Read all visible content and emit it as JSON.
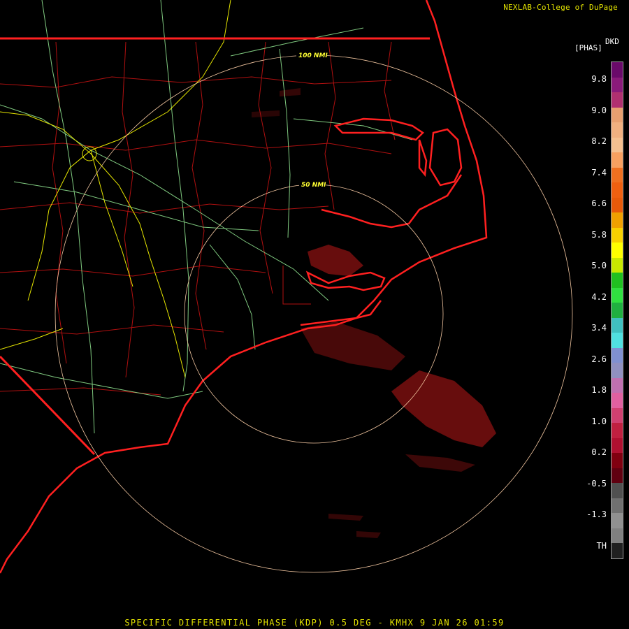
{
  "credit": "NEXLAB-College of DuPage",
  "colorbar": {
    "product_code": "DKD",
    "units": "[PHAS]",
    "tick_labels": [
      "9.8",
      "9.0",
      "8.2",
      "7.4",
      "6.6",
      "5.8",
      "5.0",
      "4.2",
      "3.4",
      "2.6",
      "1.8",
      "1.0",
      "0.2",
      "-0.5",
      "-1.3",
      "TH"
    ],
    "colors": [
      "#6a0a6a",
      "#8a1a7a",
      "#b03070",
      "#e8a070",
      "#f0b080",
      "#f5c090",
      "#f8a060",
      "#f07020",
      "#f06010",
      "#e85a0a",
      "#f0a000",
      "#f8d000",
      "#ffff00",
      "#c8e800",
      "#20c020",
      "#30e040",
      "#20b040",
      "#40c0c0",
      "#50e0e0",
      "#8090d0",
      "#9090c0",
      "#c070b0",
      "#e060a0",
      "#d04070",
      "#c02040",
      "#b01030",
      "#800010",
      "#600010",
      "#505050",
      "#707070",
      "#909090",
      "#808080",
      "#202020"
    ]
  },
  "range_rings": [
    {
      "label": "50 NMI"
    },
    {
      "label": "100 NMI"
    }
  ],
  "footer": "SPECIFIC DIFFERENTIAL PHASE (KDP) 0.5 DEG - KMHX 9 JAN 26 01:59"
}
